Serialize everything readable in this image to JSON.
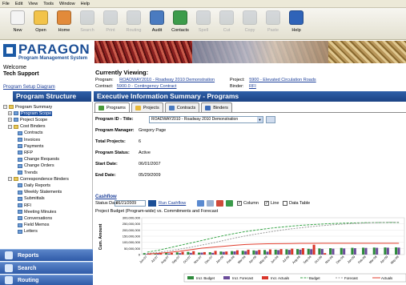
{
  "menu": [
    "File",
    "Edit",
    "View",
    "Tools",
    "Window",
    "Help"
  ],
  "toolbar": [
    {
      "label": "New",
      "icon": "new-document-icon",
      "enabled": true,
      "color": "#f4f4f4"
    },
    {
      "label": "Open",
      "icon": "folder-icon",
      "enabled": true,
      "color": "#f2c34a"
    },
    {
      "label": "Home",
      "icon": "home-icon",
      "enabled": true,
      "color": "#e28a3a"
    },
    {
      "label": "Search",
      "icon": "search-icon",
      "enabled": false,
      "color": "#9aa7bb"
    },
    {
      "label": "Print",
      "icon": "print-icon",
      "enabled": false,
      "color": "#9aa7bb"
    },
    {
      "label": "Routing",
      "icon": "routing-icon",
      "enabled": false,
      "color": "#9aa7bb"
    },
    {
      "label": "Audit",
      "icon": "audit-icon",
      "enabled": true,
      "color": "#4a7bc0"
    },
    {
      "label": "Contacts",
      "icon": "contacts-icon",
      "enabled": true,
      "color": "#3c9b4a"
    },
    {
      "label": "Spell",
      "icon": "spell-check-icon",
      "enabled": false,
      "color": "#9aa7bb"
    },
    {
      "label": "Cut",
      "icon": "cut-icon",
      "enabled": false,
      "color": "#9aa7bb"
    },
    {
      "label": "Copy",
      "icon": "copy-icon",
      "enabled": false,
      "color": "#9aa7bb"
    },
    {
      "label": "Paste",
      "icon": "paste-icon",
      "enabled": false,
      "color": "#9aa7bb"
    },
    {
      "label": "Help",
      "icon": "help-icon",
      "enabled": true,
      "color": "#2f63b8"
    }
  ],
  "header": {
    "title": "PARAGON",
    "subtitle": "Program Management System"
  },
  "welcome": {
    "greeting": "Welcome",
    "user": "Tech Support",
    "setup_link": "Program Setup Diagram"
  },
  "viewing": {
    "title": "Currently Viewing:",
    "program_label": "Program:",
    "program_value": "ROADWAY2010 - Roadway 2010 Demonstration",
    "contract_label": "Contract:",
    "contract_value": "5900.0 - Contingency Contract",
    "project_label": "Project:",
    "project_value": "5900 - Elevated Circulation Roads",
    "binder_label": "Binder:",
    "binder_value": "RFI"
  },
  "left_panel": {
    "title": "Program Structure",
    "tree": [
      {
        "label": "Program Summary",
        "type": "folder",
        "expander": "minus"
      },
      {
        "label": "Program Scope",
        "type": "file",
        "selected": true,
        "expander": "plus"
      },
      {
        "label": "Project Scope",
        "type": "file",
        "expander": "plus"
      },
      {
        "label": "Cost Binders",
        "type": "folder",
        "expander": "minus"
      },
      {
        "label": "Contracts",
        "type": "file"
      },
      {
        "label": "Invoices",
        "type": "file"
      },
      {
        "label": "Payments",
        "type": "file"
      },
      {
        "label": "RFP",
        "type": "file"
      },
      {
        "label": "Change Requests",
        "type": "file"
      },
      {
        "label": "Change Orders",
        "type": "file"
      },
      {
        "label": "Trends",
        "type": "file"
      },
      {
        "label": "Correspondence Binders",
        "type": "folder",
        "expander": "minus"
      },
      {
        "label": "Daily Reports",
        "type": "file"
      },
      {
        "label": "Weekly Statements",
        "type": "file"
      },
      {
        "label": "Submittals",
        "type": "file"
      },
      {
        "label": "RFI",
        "type": "file"
      },
      {
        "label": "Meeting Minutes",
        "type": "file"
      },
      {
        "label": "Conversations",
        "type": "file"
      },
      {
        "label": "Field Memos",
        "type": "file"
      },
      {
        "label": "Letters",
        "type": "file"
      }
    ],
    "nav": [
      {
        "label": "Reports",
        "icon": "reports-icon"
      },
      {
        "label": "Search",
        "icon": "search-icon"
      },
      {
        "label": "Routing",
        "icon": "routing-icon"
      }
    ]
  },
  "main": {
    "title": "Executive Information Summary - Programs",
    "tabs": [
      {
        "label": "Programs",
        "active": true,
        "icon_color": "#4a9a3a"
      },
      {
        "label": "Projects",
        "active": false,
        "icon_color": "#e8b83a"
      },
      {
        "label": "Contracts",
        "active": false,
        "icon_color": "#4a7bc0"
      },
      {
        "label": "Binders",
        "active": false,
        "icon_color": "#3a6ab8"
      }
    ],
    "program_id_label": "Program ID - Title:",
    "program_id_value": "ROADWAY2010 - Roadway 2010 Demonstration",
    "fields": [
      {
        "label": "Program Manager:",
        "value": "Gregory Page"
      },
      {
        "label": "Total Projects:",
        "value": "6"
      },
      {
        "label": "Program Status:",
        "value": "Active"
      },
      {
        "label": "Start Date:",
        "value": "06/01/2007"
      },
      {
        "label": "End Date:",
        "value": "05/29/2009"
      }
    ],
    "cashflow": {
      "title": "Cashflow",
      "status_label": "Status Date:",
      "status_value": "01/21/2009",
      "run_label": "Run Cashflow",
      "opt_column": "Column",
      "opt_line": "Line",
      "opt_table": "Data Table",
      "column_checked": true,
      "line_checked": true,
      "table_checked": false
    }
  },
  "chart_data": {
    "type": "bar",
    "title": "Project Budget (Program-wide) vs. Commitments and Forecast",
    "ylabel": "Cum. Amount",
    "ylim": [
      0,
      300000000
    ],
    "yticks": [
      "0",
      "50,000,000",
      "100,000,000",
      "150,000,000",
      "200,000,000",
      "250,000,000",
      "300,000,000"
    ],
    "categories": [
      "Jun-07",
      "Jul-07",
      "Aug-07",
      "Sep-07",
      "Oct-07",
      "Nov-07",
      "Dec-07",
      "Jan-08",
      "Feb-08",
      "Mar-08",
      "Apr-08",
      "May-08",
      "Jun-08",
      "Jul-08",
      "Aug-08",
      "Sep-08",
      "Oct-08",
      "Nov-08",
      "Dec-08",
      "Jan-09",
      "Feb-09",
      "Mar-09",
      "Apr-09",
      "May-09"
    ],
    "series": [
      {
        "name": "Incr. Budget",
        "color": "#2e8b3c",
        "values": [
          12000000,
          9000000,
          15000000,
          18000000,
          22000000,
          16000000,
          19000000,
          25000000,
          28000000,
          31000000,
          34000000,
          37000000,
          40000000,
          43000000,
          45000000,
          47000000,
          50000000,
          52000000,
          54000000,
          55000000,
          56000000,
          57000000,
          58000000,
          59000000
        ]
      },
      {
        "name": "Incr. Forecast",
        "color": "#6b4c9a",
        "values": [
          5000000,
          7000000,
          9000000,
          12000000,
          14000000,
          16000000,
          14000000,
          22000000,
          26000000,
          28000000,
          30000000,
          24000000,
          36000000,
          38000000,
          40000000,
          44000000,
          46000000,
          48000000,
          50000000,
          52000000,
          54000000,
          55000000,
          56000000,
          57000000
        ]
      },
      {
        "name": "Incr. Actuals",
        "color": "#d9362b",
        "values": [
          8000000,
          15000000,
          14000000,
          22000000,
          28000000,
          20000000,
          30000000,
          25000000,
          35000000,
          40000000,
          38000000,
          42000000,
          45000000,
          48000000,
          52000000,
          80000000,
          12000000,
          0,
          0,
          0,
          0,
          0,
          0,
          0
        ]
      },
      {
        "name": "Budget",
        "color": "#3aa64a",
        "values": [
          20000000,
          35000000,
          55000000,
          75000000,
          95000000,
          115000000,
          135000000,
          155000000,
          172000000,
          188000000,
          200000000,
          212000000,
          222000000,
          230000000,
          238000000,
          244000000,
          249000000,
          253000000,
          256000000,
          258000000,
          260000000,
          261000000,
          262000000,
          262000000
        ]
      },
      {
        "name": "Forecast",
        "color": "#9a9a9a",
        "values": [
          10000000,
          18000000,
          30000000,
          45000000,
          60000000,
          78000000,
          95000000,
          115000000,
          135000000,
          152000000,
          168000000,
          182000000,
          196000000,
          208000000,
          218000000,
          228000000,
          236000000,
          243000000,
          249000000,
          254000000,
          258000000,
          261000000,
          263000000,
          264000000
        ]
      },
      {
        "name": "Actuals",
        "color": "#e03c2c",
        "values": [
          5000000,
          10000000,
          18000000,
          28000000,
          40000000,
          52000000,
          60000000,
          68000000,
          76000000,
          82000000,
          86000000,
          88000000,
          89000000,
          90000000,
          91000000,
          91000000,
          92000000,
          92000000,
          92000000,
          92000000,
          92000000,
          92000000,
          92000000,
          92000000
        ]
      }
    ],
    "legend": "bottom"
  }
}
